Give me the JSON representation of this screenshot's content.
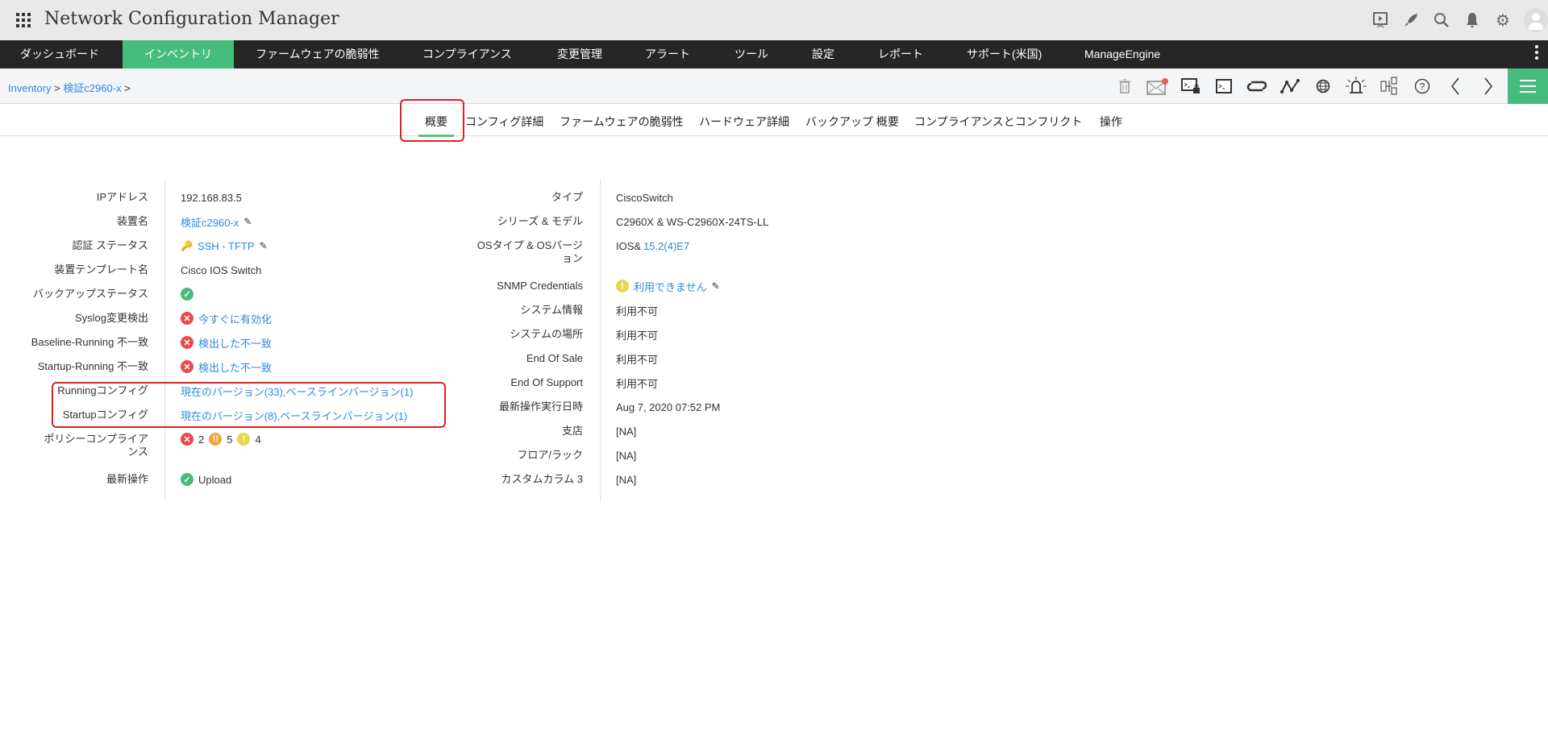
{
  "app": {
    "title": "Network Configuration Manager"
  },
  "header_icons": [
    "presentation-icon",
    "rocket-icon",
    "search-icon",
    "bell-icon",
    "gear-icon",
    "user-avatar-icon"
  ],
  "nav": {
    "items": [
      "ダッシュボード",
      "インベントリ",
      "ファームウェアの脆弱性",
      "コンプライアンス",
      "変更管理",
      "アラート",
      "ツール",
      "設定",
      "レポート",
      "サポート(米国)",
      "ManageEngine"
    ],
    "active": 1
  },
  "breadcrumb": {
    "items": [
      "Inventory",
      "検証c2960-x"
    ],
    "sep": ">"
  },
  "toolbar_icons": [
    "trash-icon",
    "mail-icon",
    "terminal-lock-icon",
    "terminal-icon",
    "sync-icon",
    "topology-icon",
    "globe-icon",
    "alarm-icon",
    "config-compare-icon",
    "help-icon",
    "prev-icon",
    "next-icon",
    "menu-icon"
  ],
  "tabs": {
    "items": [
      "概要",
      "コンフィグ詳細",
      "ファームウェアの脆弱性",
      "ハードウェア詳細",
      "バックアップ 概要",
      "コンプライアンスとコンフリクト",
      "操作"
    ],
    "active": 0
  },
  "left": [
    {
      "label": "IPアドレス",
      "value": "192.168.83.5"
    },
    {
      "label": "装置名",
      "value": "検証c2960-x"
    },
    {
      "label": "認証 ステータス",
      "value": "SSH - TFTP"
    },
    {
      "label": "装置テンプレート名",
      "value": "Cisco IOS Switch"
    },
    {
      "label": "バックアップステータス",
      "value": ""
    },
    {
      "label": "Syslog変更検出",
      "value": "今すぐに有効化"
    },
    {
      "label": "Baseline-Running 不一致",
      "value": "検出した不一致"
    },
    {
      "label": "Startup-Running 不一致",
      "value": "検出した不一致"
    },
    {
      "label": "Runningコンフィグ",
      "value": "現在のバージョン(33),ベースラインバージョン(1)"
    },
    {
      "label": "Startupコンフィグ",
      "value": "現在のバージョン(8),ベースラインバージョン(1)"
    },
    {
      "label": "ポリシーコンプライアンス",
      "counts": {
        "error": "2",
        "major": "5",
        "warning": "4"
      }
    },
    {
      "label": "最新操作",
      "value": "Upload"
    }
  ],
  "right": [
    {
      "label": "タイプ",
      "value": "CiscoSwitch"
    },
    {
      "label": "シリーズ & モデル",
      "value": "C2960X & WS-C2960X-24TS-LL"
    },
    {
      "label": "OSタイプ & OSバージョン",
      "value": "IOS&",
      "link": "15.2(4)E7"
    },
    {
      "label": "SNMP Credentials",
      "value": "利用できません"
    },
    {
      "label": "システム情報",
      "value": "利用不可"
    },
    {
      "label": "システムの場所",
      "value": "利用不可"
    },
    {
      "label": "End Of Sale",
      "value": "利用不可"
    },
    {
      "label": "End Of Support",
      "value": "利用不可"
    },
    {
      "label": "最新操作実行日時",
      "value": "Aug 7, 2020 07:52 PM"
    },
    {
      "label": "支店",
      "value": "[NA]"
    },
    {
      "label": "フロア/ラック",
      "value": "[NA]"
    },
    {
      "label": "カスタムカラム 3",
      "value": "[NA]"
    }
  ],
  "colors": {
    "accent": "#46bd7c",
    "link": "#2a8ae0",
    "nav_bg": "#262626",
    "highlight": "#e02020"
  }
}
